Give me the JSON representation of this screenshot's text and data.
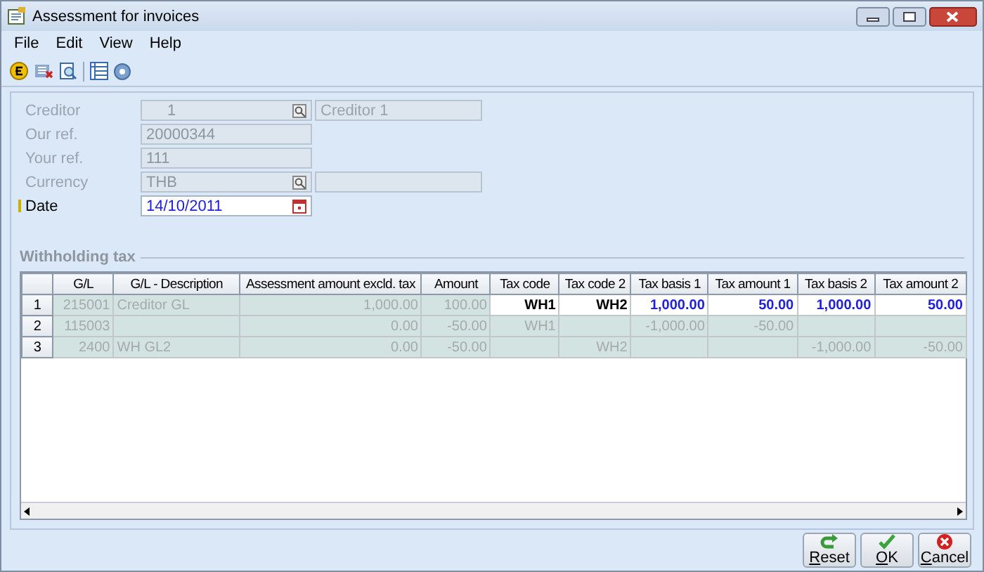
{
  "window": {
    "title": "Assessment for invoices"
  },
  "menu": [
    "File",
    "Edit",
    "View",
    "Help"
  ],
  "form": [
    {
      "kind": "lookup",
      "label": "Creditor",
      "value": "1",
      "name": "Creditor 1",
      "enabled": false,
      "required": false
    },
    {
      "kind": "text",
      "label": "Our ref.",
      "value": "20000344",
      "enabled": false,
      "required": false
    },
    {
      "kind": "text",
      "label": "Your ref.",
      "value": "111",
      "enabled": false,
      "required": false
    },
    {
      "kind": "lookup",
      "label": "Currency",
      "value": "THB",
      "enabled": false,
      "required": false
    },
    {
      "kind": "date",
      "label": "Date",
      "value": "14/10/2011",
      "enabled": true,
      "required": true
    }
  ],
  "section": "Withholding tax",
  "table": {
    "columns": [
      {
        "label": "G/L",
        "kind": "number"
      },
      {
        "label": "G/L - Description",
        "kind": "text"
      },
      {
        "label": "Assessment amount excld. tax",
        "kind": "number"
      },
      {
        "label": "Amount",
        "kind": "number"
      },
      {
        "label": "Tax code",
        "kind": "code"
      },
      {
        "label": "Tax code 2",
        "kind": "code"
      },
      {
        "label": "Tax basis 1",
        "kind": "number"
      },
      {
        "label": "Tax amount 1",
        "kind": "number"
      },
      {
        "label": "Tax basis 2",
        "kind": "number"
      },
      {
        "label": "Tax amount 2",
        "kind": "number"
      }
    ],
    "rows": [
      {
        "number": "1",
        "cells": [
          {
            "text": "215001",
            "enabled": false
          },
          {
            "text": "Creditor GL",
            "enabled": false
          },
          {
            "text": "1,000.00",
            "enabled": false
          },
          {
            "text": "100.00",
            "enabled": false
          },
          {
            "text": "WH1",
            "enabled": true
          },
          {
            "text": "WH2",
            "enabled": true
          },
          {
            "text": "1,000.00",
            "enabled": true
          },
          {
            "text": "50.00",
            "enabled": true
          },
          {
            "text": "1,000.00",
            "enabled": true
          },
          {
            "text": "50.00",
            "enabled": true
          }
        ]
      },
      {
        "number": "2",
        "cells": [
          {
            "text": "115003",
            "enabled": false
          },
          {
            "enabled": false
          },
          {
            "text": "0.00",
            "enabled": false
          },
          {
            "text": "-50.00",
            "enabled": false
          },
          {
            "text": "WH1",
            "enabled": false
          },
          {
            "enabled": false
          },
          {
            "text": "-1,000.00",
            "enabled": false
          },
          {
            "text": "-50.00",
            "enabled": false
          },
          {
            "enabled": false
          },
          {
            "enabled": false
          }
        ]
      },
      {
        "number": "3",
        "cells": [
          {
            "text": "2400",
            "enabled": false
          },
          {
            "text": "WH GL2",
            "enabled": false
          },
          {
            "text": "0.00",
            "enabled": false
          },
          {
            "text": "-50.00",
            "enabled": false
          },
          {
            "enabled": false
          },
          {
            "text": "WH2",
            "enabled": false
          },
          {
            "enabled": false
          },
          {
            "enabled": false
          },
          {
            "text": "-1,000.00",
            "enabled": false
          },
          {
            "text": "-50.00",
            "enabled": false
          }
        ]
      }
    ]
  },
  "buttons": [
    {
      "kind": "reset",
      "key": "R",
      "rest": "eset"
    },
    {
      "kind": "ok",
      "key": "O",
      "rest": "K"
    },
    {
      "kind": "cancel",
      "key": "C",
      "rest": "ancel"
    }
  ]
}
